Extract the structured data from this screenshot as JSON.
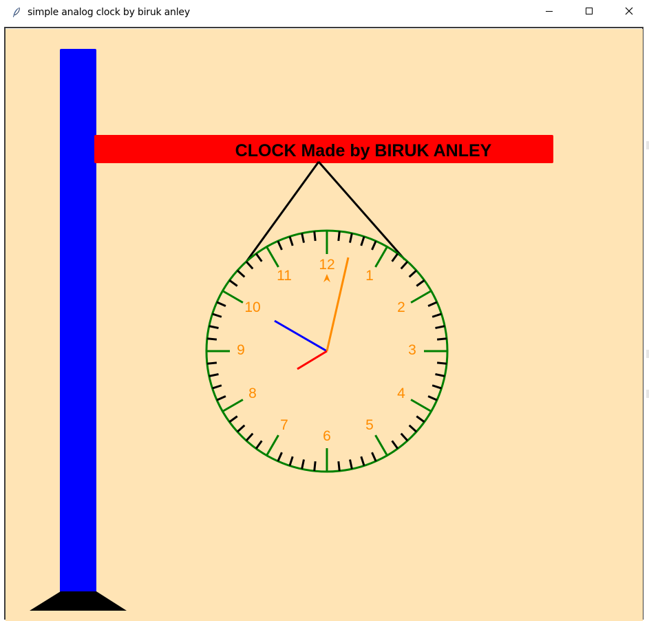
{
  "window": {
    "title": "simple analog clock by biruk anley",
    "icon": "tk-feather-icon",
    "controls": [
      "minimize-icon",
      "maximize-icon",
      "close-icon"
    ]
  },
  "banner": {
    "text": "CLOCK Made by BIRUK ANLEY",
    "color": "#ff0000",
    "text_color": "#000000"
  },
  "stand": {
    "color": "#0000ff",
    "base_color": "#000000"
  },
  "clock": {
    "numbers": [
      "12",
      "1",
      "2",
      "3",
      "4",
      "5",
      "6",
      "7",
      "8",
      "9",
      "10",
      "11"
    ],
    "number_color": "#ff8c00",
    "rim_color": "#008000",
    "hour_tick_color": "#008000",
    "minute_tick_color": "#000000",
    "hands": {
      "hour": {
        "color": "#0000ff"
      },
      "minute": {
        "color": "#ff8c00"
      },
      "second": {
        "color": "#ff0000"
      }
    }
  },
  "colors": {
    "background": "#FFE4B5"
  }
}
